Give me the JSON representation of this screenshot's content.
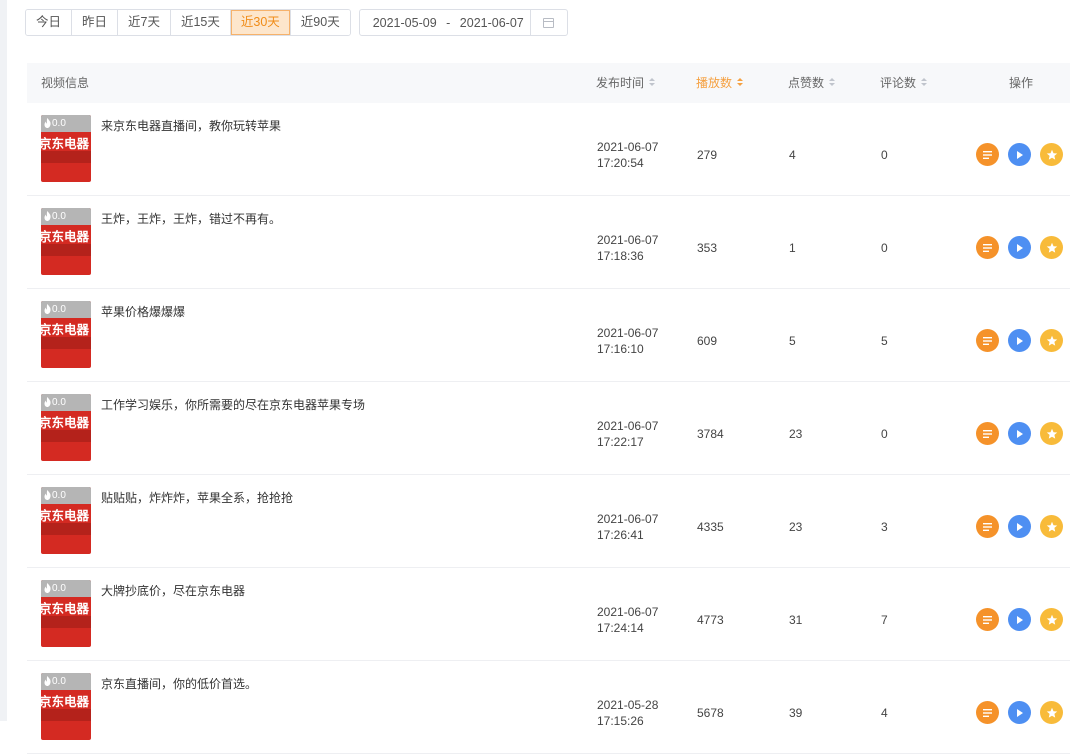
{
  "filters": {
    "ranges": [
      "今日",
      "昨日",
      "近7天",
      "近15天",
      "近30天",
      "近90天"
    ],
    "active_range": "近30天",
    "date_start": "2021-05-09",
    "date_sep": "-",
    "date_end": "2021-06-07"
  },
  "table": {
    "headers": {
      "info": "视频信息",
      "time": "发布时间",
      "plays": "播放数",
      "likes": "点赞数",
      "comments": "评论数",
      "ops": "操作"
    },
    "sorted_column": "plays",
    "thumb_brand": "京东电器",
    "rows": [
      {
        "heat": "0.0",
        "title": "来京东电器直播间，教你玩转苹果",
        "date": "2021-06-07",
        "time": "17:20:54",
        "plays": "279",
        "likes": "4",
        "comments": "0"
      },
      {
        "heat": "0.0",
        "title": "王炸，王炸，王炸，错过不再有。",
        "date": "2021-06-07",
        "time": "17:18:36",
        "plays": "353",
        "likes": "1",
        "comments": "0"
      },
      {
        "heat": "0.0",
        "title": "苹果价格爆爆爆",
        "date": "2021-06-07",
        "time": "17:16:10",
        "plays": "609",
        "likes": "5",
        "comments": "5"
      },
      {
        "heat": "0.0",
        "title": "工作学习娱乐，你所需要的尽在京东电器苹果专场",
        "date": "2021-06-07",
        "time": "17:22:17",
        "plays": "3784",
        "likes": "23",
        "comments": "0"
      },
      {
        "heat": "0.0",
        "title": "贴贴贴，炸炸炸，苹果全系，抢抢抢",
        "date": "2021-06-07",
        "time": "17:26:41",
        "plays": "4335",
        "likes": "23",
        "comments": "3"
      },
      {
        "heat": "0.0",
        "title": "大牌抄底价，尽在京东电器",
        "date": "2021-06-07",
        "time": "17:24:14",
        "plays": "4773",
        "likes": "31",
        "comments": "7"
      },
      {
        "heat": "0.0",
        "title": "京东直播间，你的低价首选。",
        "date": "2021-05-28",
        "time": "17:15:26",
        "plays": "5678",
        "likes": "39",
        "comments": "4"
      }
    ],
    "op_icons": [
      "list-icon",
      "play-icon",
      "star-icon"
    ],
    "op_colors": [
      "#f5922a",
      "#4e8ff2",
      "#f8bb3a"
    ]
  },
  "colors": {
    "accent": "#f08c18",
    "active_bg": "#fde6cc",
    "thumb_red": "#d42a22"
  }
}
